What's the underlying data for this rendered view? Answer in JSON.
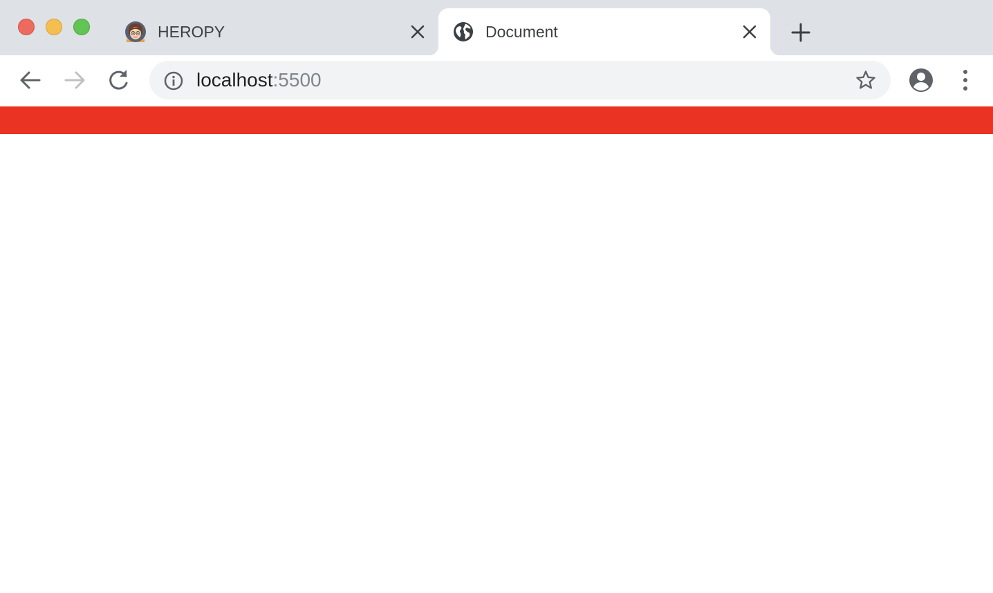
{
  "window": {
    "traffic_lights": {
      "close_color": "#ed6a5e",
      "minimize_color": "#f5bf4f",
      "maximize_color": "#61c454"
    }
  },
  "tabs": [
    {
      "title": "HEROPY",
      "icon": "avatar-favicon-icon",
      "active": false
    },
    {
      "title": "Document",
      "icon": "globe-icon",
      "active": true
    }
  ],
  "toolbar": {
    "back_icon": "arrow-left-icon",
    "forward_icon": "arrow-right-icon",
    "reload_icon": "reload-icon",
    "profile_icon": "account-circle-icon",
    "menu_icon": "kebab-menu-icon"
  },
  "omnibox": {
    "host": "localhost",
    "port": ":5500",
    "info_icon": "info-icon",
    "bookmark_icon": "star-icon"
  },
  "page": {
    "bar_color": "#ea3323",
    "background": "#ffffff"
  }
}
